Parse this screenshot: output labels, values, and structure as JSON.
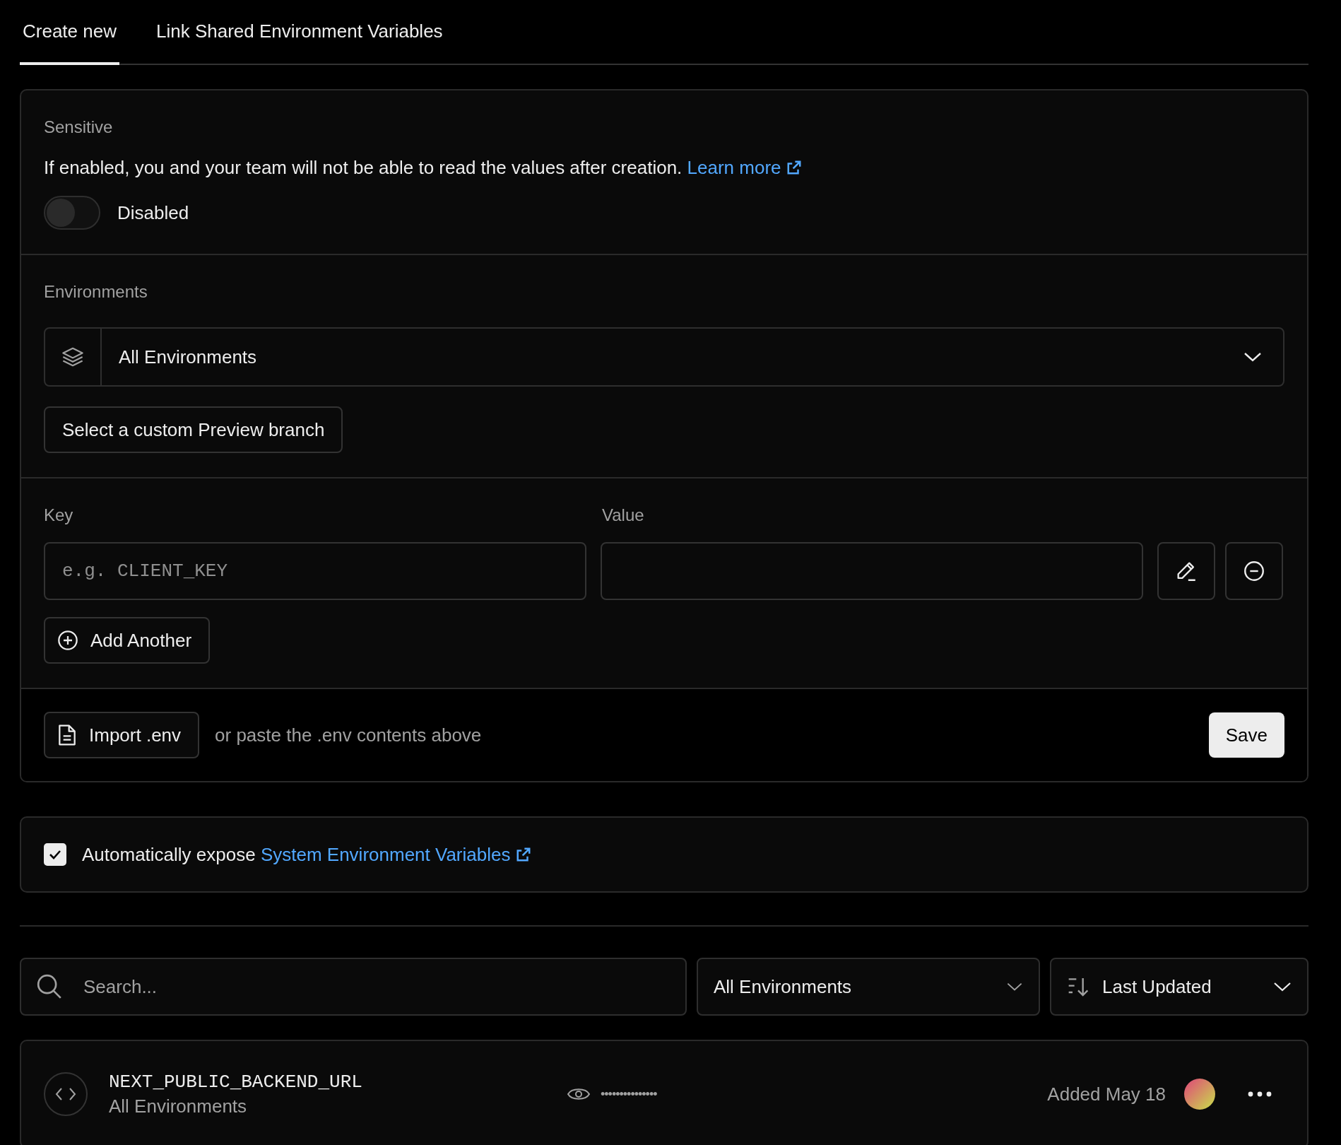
{
  "tabs": [
    {
      "label": "Create new",
      "selected": true
    },
    {
      "label": "Link Shared Environment Variables",
      "selected": false
    }
  ],
  "sensitive": {
    "label": "Sensitive",
    "description": "If enabled, you and your team will not be able to read the values after creation.",
    "link": "Learn more",
    "toggle": {
      "on": false,
      "label": "Disabled"
    }
  },
  "environments": {
    "label": "Environments",
    "select": "All Environments",
    "branch_button": "Select a custom Preview branch"
  },
  "variables": {
    "key_label": "Key",
    "value_label": "Value",
    "pairs": [
      {
        "key_placeholder": "e.g. CLIENT_KEY"
      }
    ],
    "add_button": "Add Another"
  },
  "footer": {
    "import_button": "Import .env",
    "hint": "or paste the .env contents above",
    "save_button": "Save"
  },
  "auto_expose": {
    "checked": true,
    "text": "Automatically expose",
    "link": "System Environment Variables"
  },
  "filters": {
    "search_placeholder": "Search...",
    "environment": "All Environments",
    "sort": "Last Updated"
  },
  "variables_list": [
    {
      "name": "NEXT_PUBLIC_BACKEND_URL",
      "environment": "All Environments",
      "masked_value": "•••••••••••••••",
      "added": "Added May 18"
    }
  ]
}
